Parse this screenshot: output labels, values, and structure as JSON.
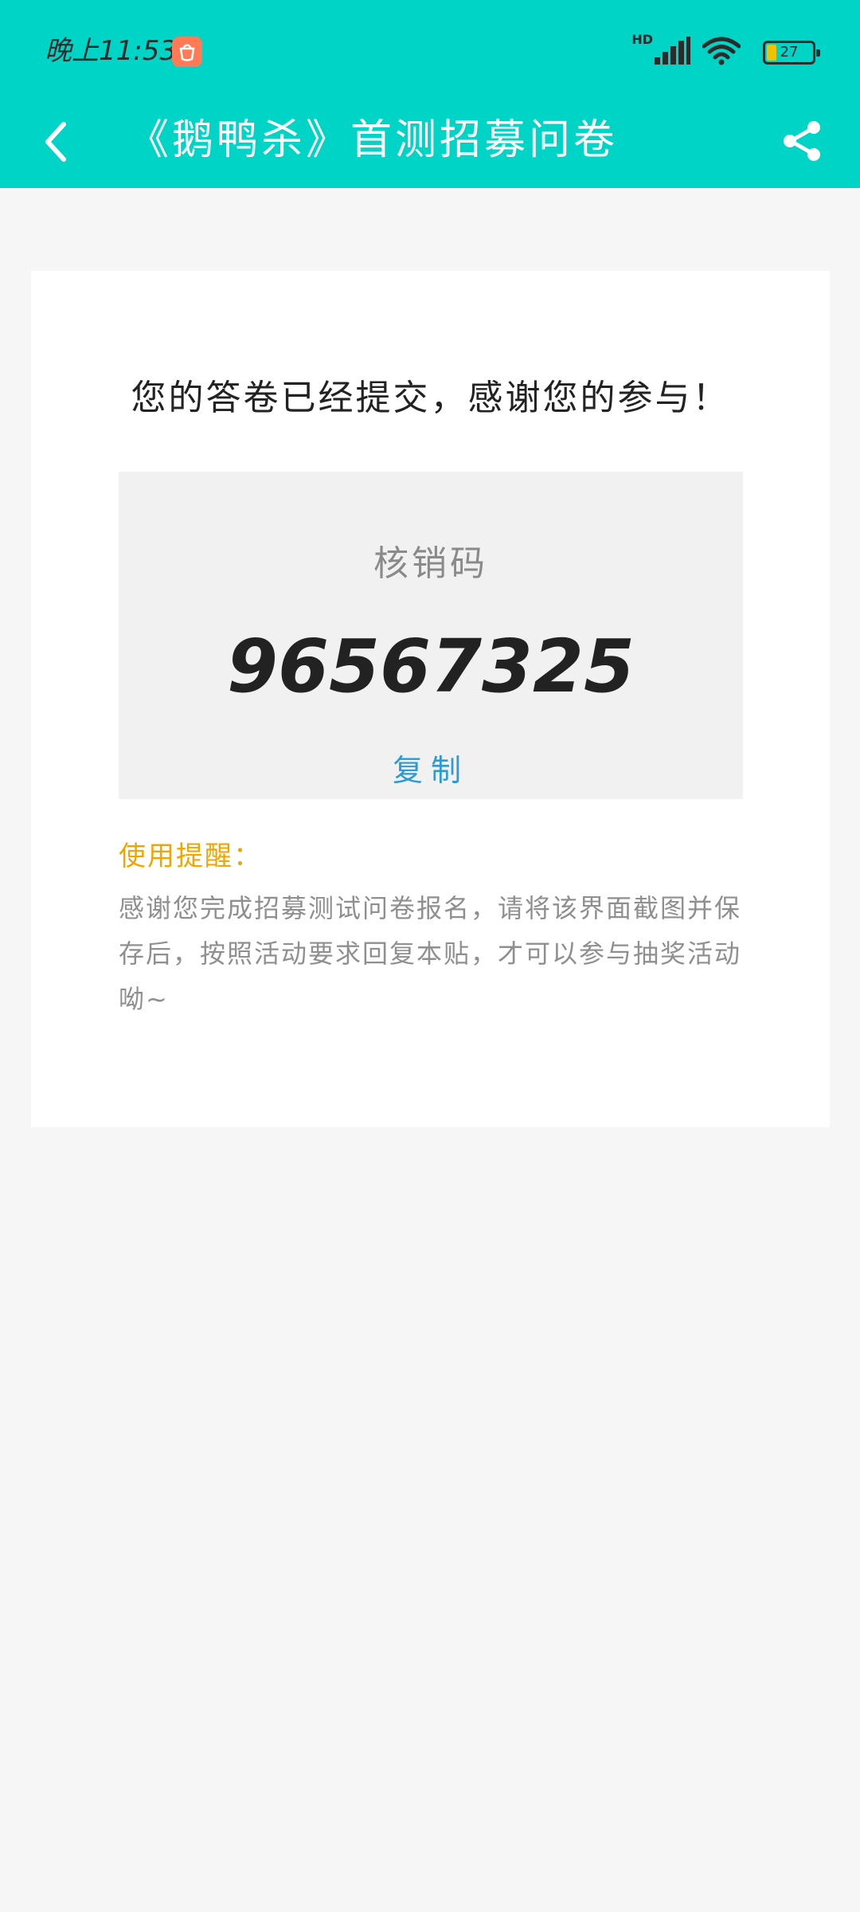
{
  "status_bar": {
    "time": "晚上11:53",
    "network_label": "HD",
    "battery_level": "27",
    "battery_fraction": 0.27,
    "icons": [
      "app-notification-icon",
      "cellular-signal-icon",
      "wifi-icon",
      "battery-icon"
    ]
  },
  "nav": {
    "title": "《鹅鸭杀》首测招募问卷",
    "back_icon": "chevron-left-icon",
    "share_icon": "share-icon"
  },
  "result": {
    "message": "您的答卷已经提交，感谢您的参与！",
    "code_label": "核销码",
    "code_value": "96567325",
    "copy_label": "复制"
  },
  "tip": {
    "title": "使用提醒：",
    "body": "感谢您完成招募测试问卷报名，请将该界面截图并保存后，按照活动要求回复本贴，才可以参与抽奖活动呦~"
  },
  "colors": {
    "header_bg": "#00d4c6",
    "page_bg": "#f6f6f6",
    "card_bg": "#ffffff",
    "code_box_bg": "#f1f1f1",
    "copy_link": "#2b9ad6",
    "tip_title": "#f0a500",
    "tip_body": "#8f8f8f"
  }
}
